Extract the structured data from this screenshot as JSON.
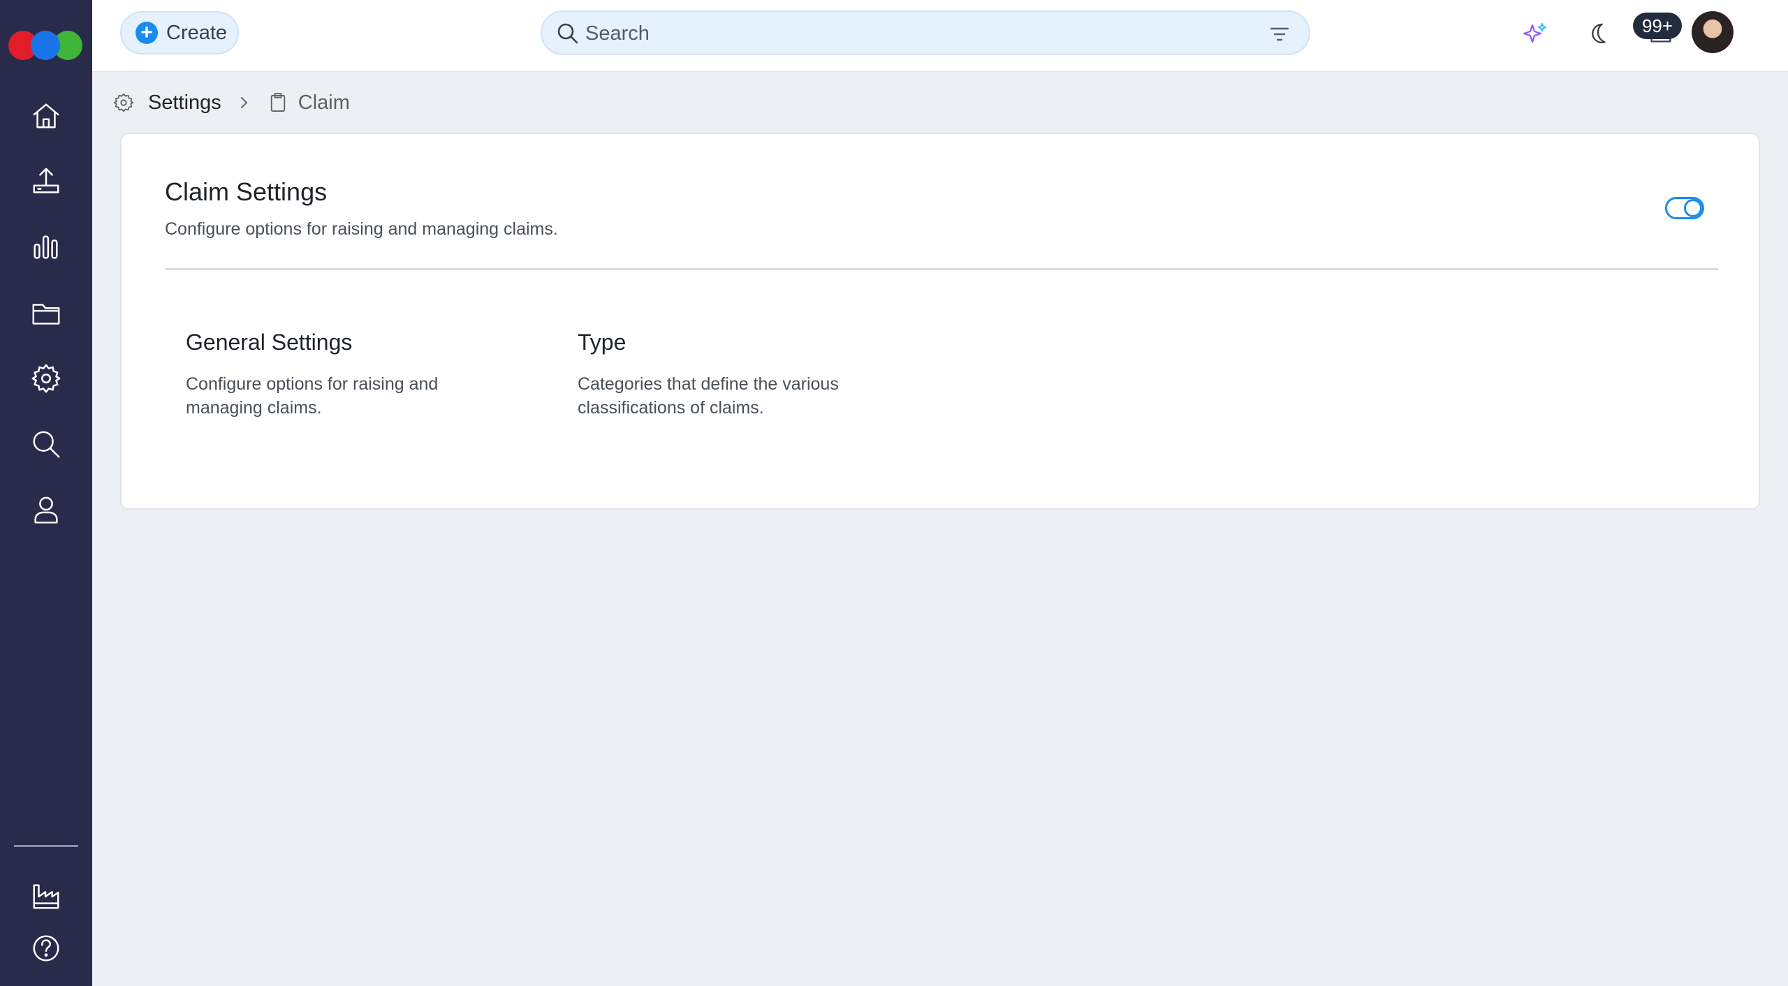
{
  "header": {
    "create_label": "Create",
    "search_placeholder": "Search",
    "notification_count": "99+"
  },
  "sidebar": {
    "items": [
      {
        "icon": "home-icon"
      },
      {
        "icon": "upload-icon"
      },
      {
        "icon": "bar-chart-icon"
      },
      {
        "icon": "folder-icon"
      },
      {
        "icon": "gear-icon"
      },
      {
        "icon": "search-icon"
      },
      {
        "icon": "user-icon"
      }
    ],
    "bottom_items": [
      {
        "icon": "factory-icon"
      },
      {
        "icon": "help-icon"
      }
    ]
  },
  "breadcrumb": {
    "items": [
      "Settings",
      "Claim"
    ]
  },
  "card": {
    "title": "Claim Settings",
    "description": "Configure options for raising and managing claims.",
    "toggle_on": true,
    "sections": [
      {
        "title": "General Settings",
        "description_line1": "Configure options for raising and",
        "description_line2": "managing claims."
      },
      {
        "title": "Type",
        "description_line1": "Categories that define the various",
        "description_line2": "classifications of claims."
      }
    ]
  },
  "colors": {
    "sidebar_bg": "#282b4a",
    "accent": "#1a8cf0",
    "page_bg": "#eceff4"
  }
}
